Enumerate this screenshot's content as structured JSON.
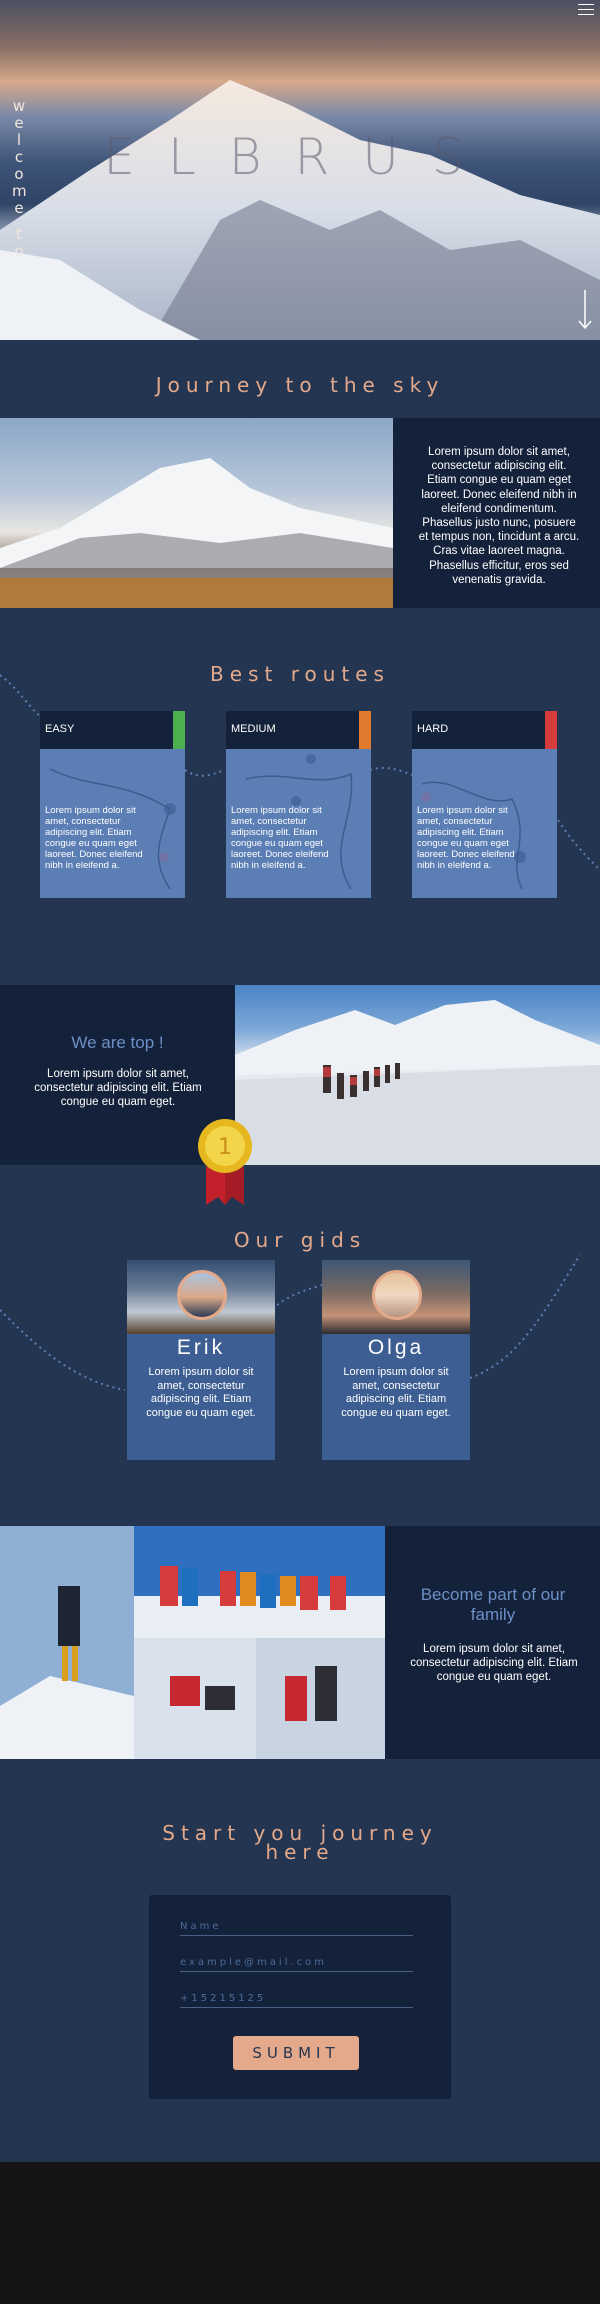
{
  "hero": {
    "vertical_text": "welcome to",
    "vertical_chars": [
      "w",
      "e",
      "l",
      "c",
      "o",
      "m",
      "e",
      " ",
      "t",
      "o"
    ],
    "title": "ELBRUS",
    "menu_icon": "hamburger-icon",
    "arrow_icon": "arrow-down-icon"
  },
  "journey": {
    "title": "Journey to the sky",
    "text": "Lorem ipsum dolor sit amet, consectetur adipiscing elit. Etiam congue eu quam eget laoreet. Donec eleifend nibh in eleifend condimentum. Phasellus justo nunc, posuere et tempus non, tincidunt a arcu. Cras vitae laoreet magna. Phasellus efficitur, eros sed venenatis gravida."
  },
  "routes": {
    "title": "Best routes",
    "items": [
      {
        "label": "EASY",
        "color": "#4caf50",
        "text": "Lorem ipsum dolor sit amet, consectetur adipiscing elit. Etiam congue eu quam eget laoreet. Donec eleifend nibh in eleifend a."
      },
      {
        "label": "MEDIUM",
        "color": "#e07b2e",
        "text": "Lorem ipsum dolor sit amet, consectetur adipiscing elit. Etiam congue eu quam eget laoreet. Donec eleifend nibh in eleifend a."
      },
      {
        "label": "HARD",
        "color": "#d63c3c",
        "text": "Lorem ipsum dolor sit amet, consectetur adipiscing elit. Etiam congue eu quam eget laoreet. Donec eleifend nibh in eleifend a."
      }
    ]
  },
  "top": {
    "title": "We are top !",
    "text": "Lorem ipsum dolor sit amet, consectetur adipiscing elit. Etiam congue eu quam eget.",
    "medal_number": "1"
  },
  "guides": {
    "title": "Our gids",
    "items": [
      {
        "name": "Erik",
        "text": "Lorem ipsum dolor sit amet, consectetur adipiscing elit. Etiam congue eu quam eget."
      },
      {
        "name": "Olga",
        "text": "Lorem ipsum dolor sit amet, consectetur adipiscing elit. Etiam congue eu quam eget."
      }
    ]
  },
  "family": {
    "title": "Become part of our family",
    "text": "Lorem ipsum dolor sit amet, consectetur adipiscing elit. Etiam congue eu quam eget."
  },
  "form": {
    "title_line1": "Start you journey",
    "title_line2": "here",
    "name_placeholder": "Name",
    "email_placeholder": "example@mail.com",
    "phone_placeholder": "+15215125",
    "submit_label": "SUBMIT"
  },
  "colors": {
    "page_bg": "#243552",
    "dark_panel": "#13223a",
    "accent": "#e3a98a",
    "blue_heading": "#6d8fc5"
  }
}
